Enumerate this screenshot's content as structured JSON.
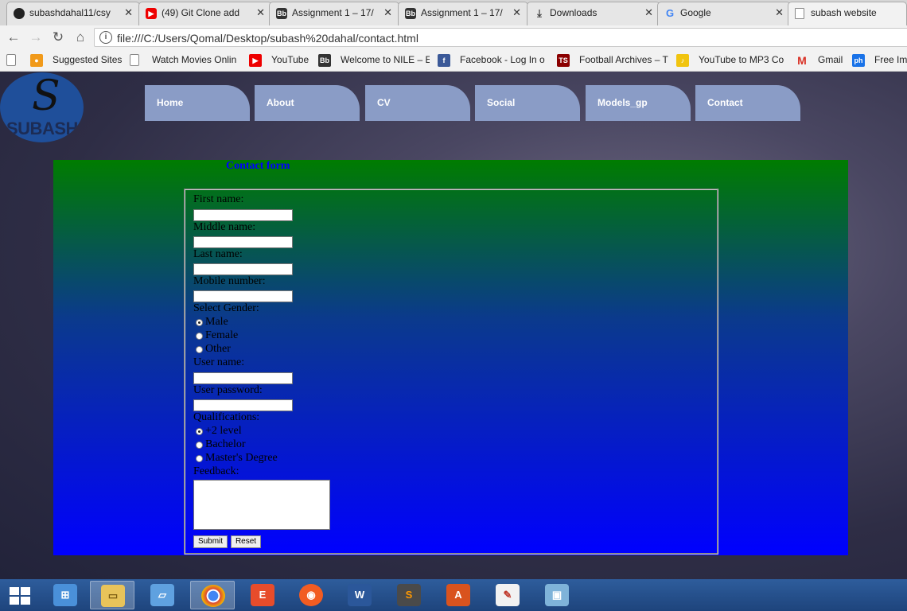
{
  "browser": {
    "tabs": [
      {
        "label": "subashdahal11/csy",
        "icon": "github-icon",
        "active": false
      },
      {
        "label": "(49) Git Clone add",
        "icon": "youtube-icon",
        "active": false
      },
      {
        "label": "Assignment 1 – 17/",
        "icon": "blackboard-icon",
        "active": false
      },
      {
        "label": "Assignment 1 – 17/",
        "icon": "blackboard-icon",
        "active": false
      },
      {
        "label": "Downloads",
        "icon": "download-icon",
        "active": false
      },
      {
        "label": "Google",
        "icon": "google-icon",
        "active": false
      },
      {
        "label": "subash website",
        "icon": "page-icon",
        "active": true
      }
    ],
    "url": "file:///C:/Users/Qomal/Desktop/subash%20dahal/contact.html",
    "bookmarks": [
      {
        "label": "Suggested Sites",
        "icon": "suggested-sites-icon"
      },
      {
        "label": "Watch Movies Onlin",
        "icon": "page-icon"
      },
      {
        "label": "YouTube",
        "icon": "youtube-icon"
      },
      {
        "label": "Welcome to NILE – E",
        "icon": "blackboard-icon"
      },
      {
        "label": "Facebook - Log In o",
        "icon": "facebook-icon"
      },
      {
        "label": "Football Archives – T",
        "icon": "ts-icon"
      },
      {
        "label": "YouTube to MP3 Co",
        "icon": "mp3-icon"
      },
      {
        "label": "Gmail",
        "icon": "gmail-icon"
      },
      {
        "label": "Free Ima",
        "icon": "ph-icon"
      }
    ]
  },
  "site": {
    "logo": {
      "letter": "S",
      "text": "SUBASH"
    },
    "nav": [
      "Home",
      "About",
      "CV",
      "Social",
      "Models_gp",
      "Contact"
    ]
  },
  "form": {
    "title": "Contact form",
    "first_name": {
      "label": "First name:",
      "value": ""
    },
    "middle_name": {
      "label": "Middle name:",
      "value": ""
    },
    "last_name": {
      "label": "Last name:",
      "value": ""
    },
    "mobile": {
      "label": "Mobile number:",
      "value": ""
    },
    "gender": {
      "label": "Select Gender:",
      "options": [
        "Male",
        "Female",
        "Other"
      ],
      "selected": "Male"
    },
    "username": {
      "label": "User name:",
      "value": ""
    },
    "password": {
      "label": "User password:",
      "value": ""
    },
    "qualifications": {
      "label": "Qualifications:",
      "options": [
        "+2 level",
        "Bachelor",
        "Master's Degree"
      ],
      "selected": "+2 level"
    },
    "feedback": {
      "label": "Feedback:",
      "value": ""
    },
    "submit_label": "Submit",
    "reset_label": "Reset"
  },
  "taskbar": {
    "apps": [
      "start-icon",
      "control-panel-icon",
      "file-explorer-icon",
      "remote-desktop-icon",
      "chrome-icon",
      "office-app-icon",
      "camera-app-icon",
      "word-icon",
      "sublime-text-icon",
      "acrobat-icon",
      "paint-icon",
      "photos-icon"
    ]
  },
  "colors": {
    "nav_tab": "#8a9cc6",
    "form_top": "#007c00",
    "form_bottom": "#0000ff",
    "logo_circle": "#1f4f9a"
  }
}
